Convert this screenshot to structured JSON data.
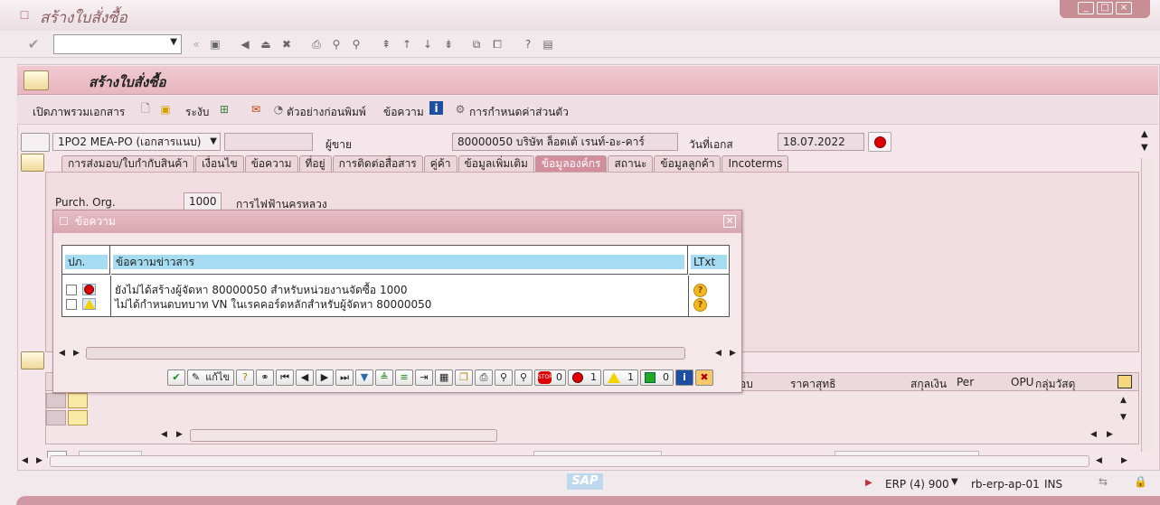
{
  "window": {
    "title": "สร้างใบสั่งซื้อ",
    "controls": [
      "_",
      "□",
      "×"
    ]
  },
  "app": {
    "title": "สร้างใบสั่งซื้อ"
  },
  "apptoolbar": {
    "overview": "เปิดภาพรวมเอกสาร",
    "hold": "ระงับ",
    "print_preview": "ตัวอย่างก่อนพิมพ์",
    "messages": "ข้อความ",
    "personal": "การกำหนดค่าส่วนตัว"
  },
  "header": {
    "doctype": "1PO2 MEA-PO (เอกสารแนบ)",
    "vendor_label": "ผู้ขาย",
    "vendor_value": "80000050 บริษัท ล็อตเต้ เรนท์-อะ-คาร์",
    "docdate_label": "วันที่เอกส",
    "docdate_value": "18.07.2022"
  },
  "tabs": [
    "การส่งมอบ/ใบกำกับสินค้า",
    "เงื่อนไข",
    "ข้อความ",
    "ที่อยู่",
    "การติดต่อสื่อสาร",
    "คู่ค้า",
    "ข้อมูลเพิ่มเติม",
    "ข้อมูลองค์กร",
    "สถานะ",
    "ข้อมูลลูกค้า",
    "Incoterms"
  ],
  "org": {
    "label": "Purch. Org.",
    "value": "1000",
    "desc": "การไฟฟ้านครหลวง"
  },
  "dialog": {
    "title": "ข้อความ",
    "col_type": "ปภ.",
    "col_text": "ข้อความข่าวสาร",
    "col_ltxt": "LTxt",
    "rows": [
      {
        "text": "ยังไม่ได้สร้างผู้จัดหา 80000050 สำหรับหน่วยงานจัดซื้อ 1000",
        "level": "error"
      },
      {
        "text": "ไม่ได้กำหนดบทบาท VN ในเรคคอร์ดหลักสำหรับผู้จัดหา 80000050",
        "level": "warning"
      }
    ],
    "edit_label": "แก้ไข",
    "count_stop": "0",
    "count_error": "1",
    "count_warning": "1",
    "count_success": "0"
  },
  "items": {
    "columns": [
      "อบ",
      "ราคาสุทธิ",
      "สกุลเงิน",
      "Per",
      "OPU",
      "กลุ่มวัสดุ"
    ]
  },
  "statusbar": {
    "system": "ERP (4) 900",
    "server": "rb-erp-ap-01",
    "mode": "INS",
    "sap": "SAP"
  },
  "colors": {
    "accent": "#d28e9c",
    "header": "#e8b6c0",
    "error": "#e00000",
    "warning": "#f2d200",
    "success": "#22aa22"
  }
}
